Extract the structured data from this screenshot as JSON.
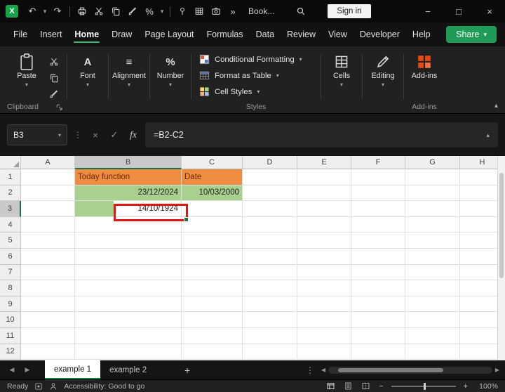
{
  "colors": {
    "accent_green": "#107C41",
    "orange_fill": "#EE8D42",
    "green_fill": "#A9D08E",
    "annotation_red": "#DE1713"
  },
  "icons": {
    "excel-logo": "X",
    "undo-icon": "↶",
    "redo-icon": "↷",
    "dropdown-icon": "▾",
    "overflow-icon": "»",
    "minimize-icon": "−",
    "maximize-icon": "□",
    "close-icon": "×",
    "cancel-icon": "×",
    "enter-icon": "✓",
    "fx-icon": "fx",
    "dots-icon": "⋮",
    "font-icon": "A",
    "alignment-icon": "≡",
    "number-icon": "%",
    "tab-prev-icon": "◀",
    "tab-next-icon": "▶",
    "scroll-left-icon": "◀",
    "scroll-right-icon": "▶",
    "add-sheet-icon": "+",
    "zoom-out-icon": "−",
    "zoom-in-icon": "+",
    "collapse-ribbon-icon": "▴",
    "expand-formula-icon": "▴"
  },
  "titlebar": {
    "workbook_title": "Book...",
    "sign_in_label": "Sign in",
    "qat": [
      {
        "name": "undo-button",
        "icon": "undo-icon"
      },
      {
        "name": "undo-menu-button",
        "icon": "dropdown-icon",
        "small": true
      },
      {
        "name": "redo-button",
        "icon": "redo-icon"
      },
      {
        "divider": true
      },
      {
        "name": "print-button",
        "icon": "printer-icon"
      },
      {
        "name": "cut-button",
        "icon": "cut-icon"
      },
      {
        "name": "copy-button",
        "icon": "copy-icon"
      },
      {
        "name": "format-painter-button",
        "icon": "brush-icon"
      },
      {
        "name": "percent-style-button",
        "icon": "number-icon"
      },
      {
        "name": "qat-menu-button",
        "icon": "dropdown-icon",
        "small": true
      },
      {
        "divider": true
      },
      {
        "name": "pin-button",
        "icon": "pin-icon"
      },
      {
        "name": "table-button",
        "icon": "table-icon"
      },
      {
        "name": "camera-button",
        "icon": "camera-icon"
      },
      {
        "name": "qat-overflow-button",
        "icon": "overflow-icon"
      }
    ]
  },
  "menubar": {
    "items": [
      "File",
      "Insert",
      "Home",
      "Draw",
      "Page Layout",
      "Formulas",
      "Data",
      "Review",
      "View",
      "Developer",
      "Help"
    ],
    "active_item": "Home",
    "share_label": "Share"
  },
  "ribbon": {
    "paste_label": "Paste",
    "clipboard_group_label": "Clipboard",
    "collapsed_groups": [
      {
        "label": "Font",
        "icon": "font-icon"
      },
      {
        "label": "Alignment",
        "icon": "alignment-icon"
      },
      {
        "label": "Number",
        "icon": "number-icon"
      }
    ],
    "styles_items": [
      {
        "label": "Conditional Formatting",
        "icon": "cond-format"
      },
      {
        "label": "Format as Table",
        "icon": "format-table"
      },
      {
        "label": "Cell Styles",
        "icon": "cell-styles"
      }
    ],
    "styles_group_label": "Styles",
    "big_groups": [
      {
        "label": "Cells",
        "icon": "cells-icon"
      },
      {
        "label": "Editing",
        "icon": "editing-icon"
      },
      {
        "label": "Add-ins",
        "icon": "addins-icon",
        "group_label": "Add-ins",
        "chevron": false
      }
    ]
  },
  "formula_bar": {
    "name_box_value": "B3",
    "formula": "=B2-C2"
  },
  "grid": {
    "column_headers": [
      "A",
      "B",
      "C",
      "D",
      "E",
      "F",
      "G",
      "H"
    ],
    "row_headers": [
      "1",
      "2",
      "3",
      "4",
      "5",
      "6",
      "7",
      "8",
      "9",
      "10",
      "11",
      "12"
    ],
    "cells": [
      {
        "ref": "B1",
        "text": "Today function",
        "fill": "orange",
        "align": "left"
      },
      {
        "ref": "C1",
        "text": "Date",
        "fill": "orange",
        "align": "left"
      },
      {
        "ref": "B2",
        "text": "23/12/2024",
        "fill": "green",
        "align": "right"
      },
      {
        "ref": "C2",
        "text": "10/03/2000",
        "fill": "green",
        "align": "right"
      },
      {
        "ref": "B3",
        "text": "14/10/1924",
        "fill": "green-left",
        "align": "right"
      }
    ],
    "selection": {
      "active_cell": "B3",
      "column": "B",
      "row": "3"
    },
    "annotation": {
      "type": "red-highlight-box",
      "cell": "B3"
    }
  },
  "sheet_tabs": {
    "tabs": [
      {
        "label": "example 1",
        "active": true
      },
      {
        "label": "example 2",
        "active": false
      }
    ]
  },
  "status_bar": {
    "mode": "Ready",
    "accessibility": "Accessibility: Good to go",
    "zoom_level": "100%"
  }
}
